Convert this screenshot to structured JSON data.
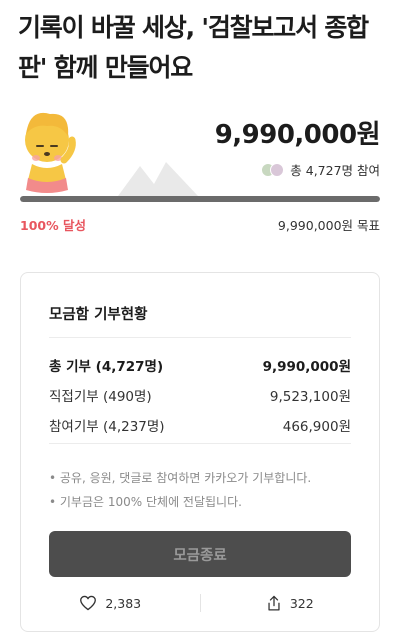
{
  "title": "기록이 바꿀 세상, '검찰보고서 종합판' 함께 만들어요",
  "amount_raised": "9,990,000원",
  "participants_text": "총 4,727명 참여",
  "progress_fraction": 1.0,
  "percent_label": "100% 달성",
  "goal_label": "9,990,000원 목표",
  "card": {
    "title": "모금함 기부현황",
    "rows": [
      {
        "label": "총 기부 (4,727명)",
        "value": "9,990,000원"
      },
      {
        "label": "직접기부 (490명)",
        "value": "9,523,100원"
      },
      {
        "label": "참여기부 (4,237명)",
        "value": "466,900원"
      }
    ],
    "notes": [
      "• 공유, 응원, 댓글로 참여하면 카카오가 기부합니다.",
      "• 기부금은 100% 단체에 전달됩니다."
    ],
    "end_button": "모금종료",
    "like_count": "2,383",
    "share_count": "322"
  },
  "colors": {
    "accent_red": "#e8565f",
    "progress_fill": "#6b6b6b",
    "button_bg": "#4d4d4d"
  },
  "icons": [
    "character-illustration",
    "mountain-icon",
    "participant-avatars",
    "heart-icon",
    "share-icon"
  ]
}
